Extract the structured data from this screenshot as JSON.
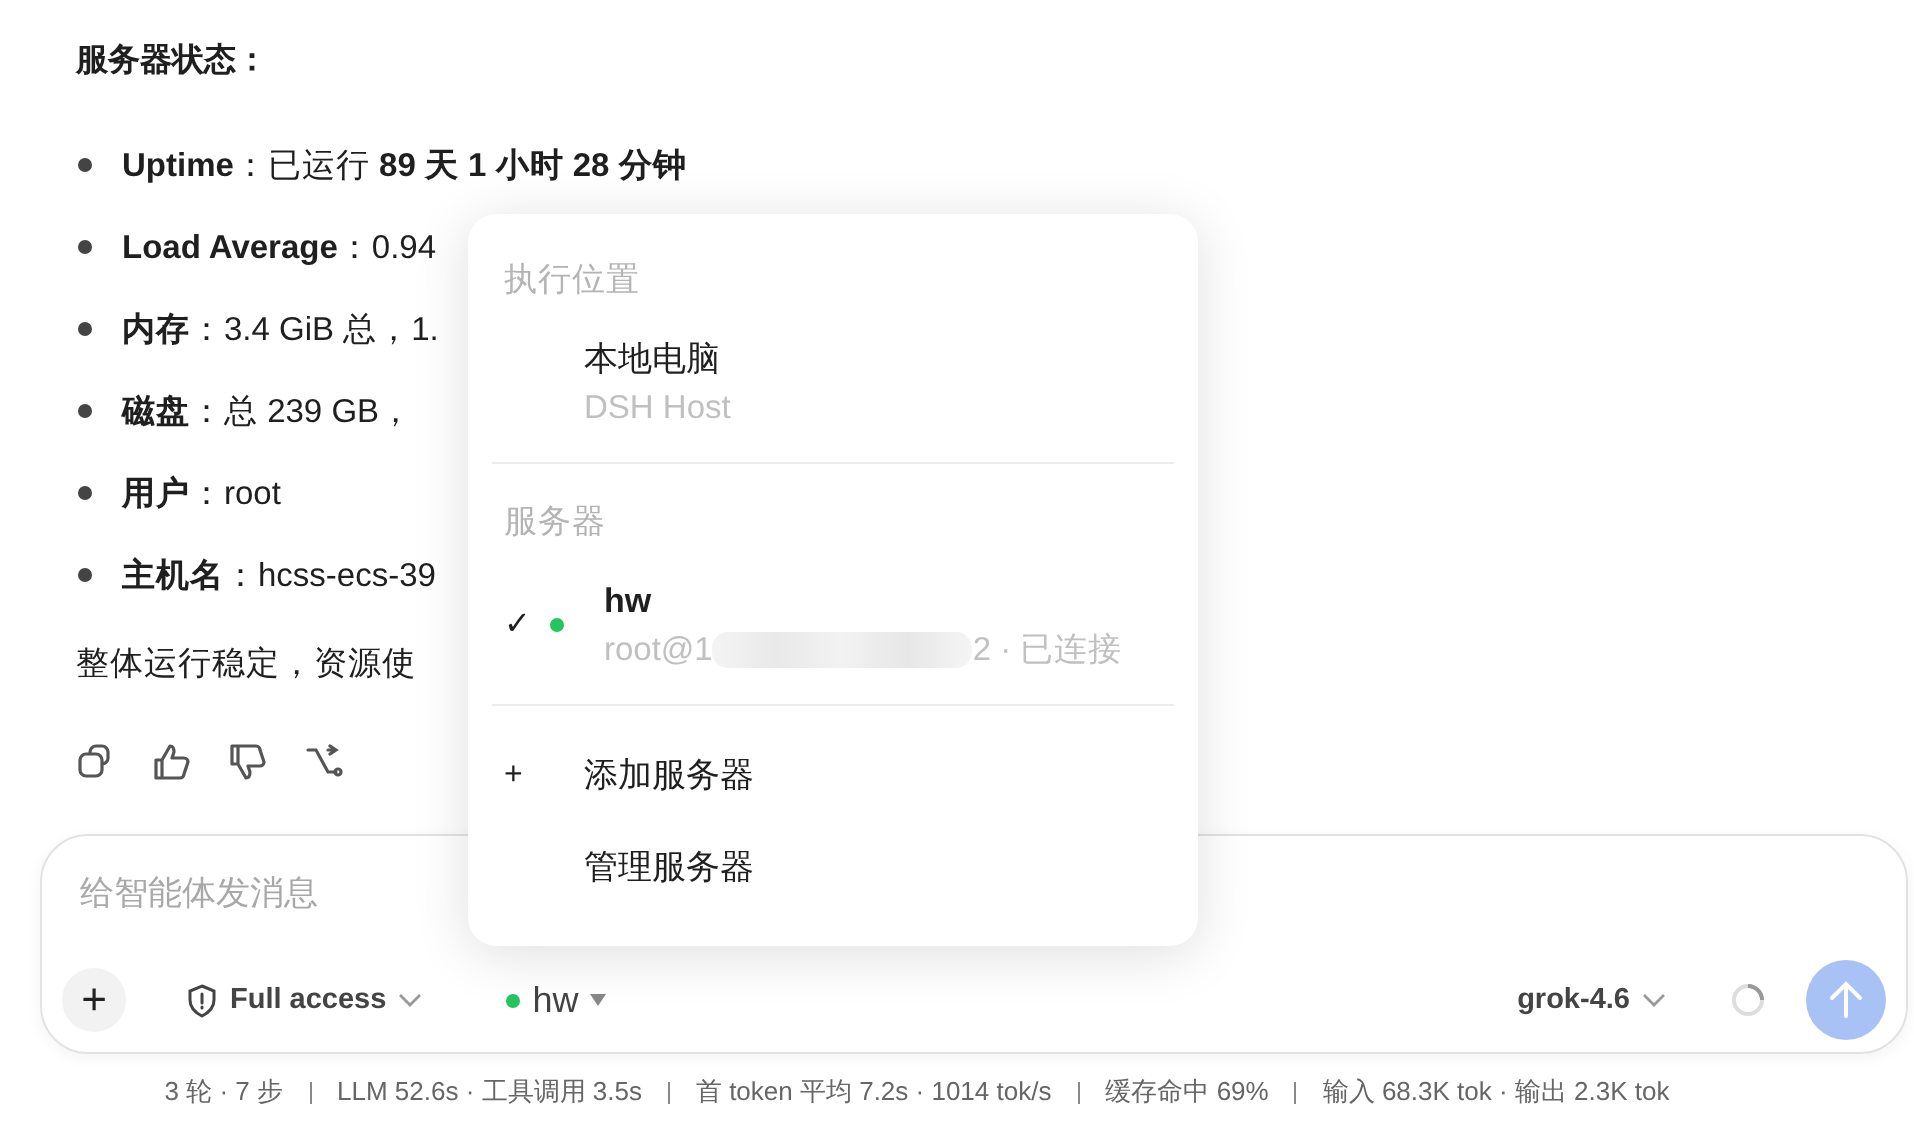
{
  "message": {
    "heading": "服务器状态：",
    "items": [
      {
        "label": "Uptime",
        "value": "：已运行 **89 天 1 小时 28 分钟**"
      },
      {
        "label": "Load Average",
        "value": "：0.94"
      },
      {
        "label": "内存",
        "value": "：3.4 GiB 总，1."
      },
      {
        "label": "磁盘",
        "value": "：总 239 GB，"
      },
      {
        "label": "用户",
        "value": "：root"
      },
      {
        "label": "主机名",
        "value": "：hcss-ecs-39"
      }
    ],
    "summary": "整体运行稳定，资源使"
  },
  "menu": {
    "sections": [
      {
        "title": "执行位置",
        "items": [
          {
            "kind": "host",
            "name": "本地电脑",
            "detail": "DSH Host",
            "selected": false
          }
        ]
      },
      {
        "title": "服务器",
        "items": [
          {
            "kind": "server",
            "name": "hw",
            "detail": "root@1",
            "detail_end": "2 · 已连接",
            "selected": true,
            "check": "✓",
            "color": "#22c55e"
          }
        ]
      },
      {
        "items": [
          {
            "kind": "add",
            "icon": "+",
            "name": "添加服务器"
          },
          {
            "kind": "action",
            "name": "管理服务器"
          }
        ]
      }
    ]
  },
  "composer": {
    "placeholder": "给智能体发消息",
    "access": "Full access",
    "server": {
      "name": "hw",
      "color": "#22c55e"
    },
    "model": "grok-4.6"
  },
  "status_bar": [
    "3 轮 · 7 步",
    "LLM 52.6s · 工具调用 3.5s",
    "首 token 平均 7.2s · 1014 tok/s",
    "缓存命中 69%",
    "输入 68.3K tok · 输出 2.3K tok"
  ]
}
